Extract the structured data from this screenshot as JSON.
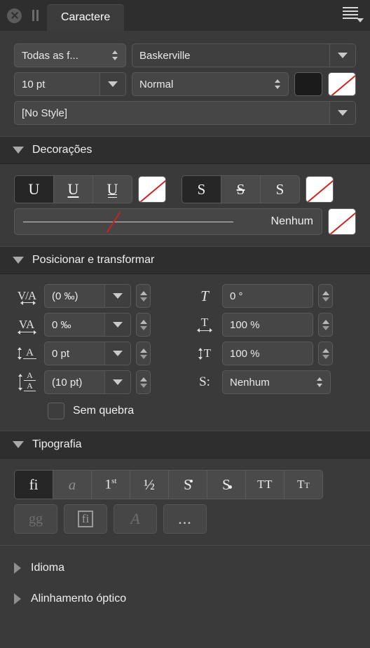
{
  "titlebar": {
    "close_icon": "close-icon",
    "pause_icon": "pause-icon",
    "tab_label": "Caractere",
    "menu_icon": "hamburger-menu-icon"
  },
  "font": {
    "family_filter": "Todas as f...",
    "family_name": "Baskerville",
    "size": "10 pt",
    "style": "Normal",
    "fill_color": "#1b1b1b",
    "stroke_color": "none",
    "paragraph_style": "[No Style]"
  },
  "decorations": {
    "title": "Decorações",
    "underline": [
      "U",
      "U",
      "U"
    ],
    "underline_selected": 0,
    "underline_color": "none",
    "strikethrough": [
      "S",
      "S",
      "S"
    ],
    "strikethrough_selected": 0,
    "strikethrough_color": "none",
    "line_style_label": "Nenhum",
    "line_style_color": "none"
  },
  "transform": {
    "title": "Posicionar e transformar",
    "kerning": {
      "icon": "kerning-icon",
      "value": "(0 ‰)"
    },
    "tracking": {
      "icon": "tracking-icon",
      "value": "0 ‰"
    },
    "baseline": {
      "icon": "baseline-shift-icon",
      "value": "0 pt"
    },
    "leading": {
      "icon": "leading-icon",
      "value": "(10 pt)"
    },
    "skew": {
      "icon": "skew-icon",
      "value": "0 °"
    },
    "hscale": {
      "icon": "horizontal-scale-icon",
      "value": "100 %"
    },
    "vscale": {
      "icon": "vertical-scale-icon",
      "value": "100 %"
    },
    "caps": {
      "icon": "small-caps-icon",
      "label": "S:",
      "value": "Nenhum"
    },
    "no_break_label": "Sem quebra",
    "no_break_checked": false
  },
  "typography": {
    "title": "Tipografia",
    "row1": [
      {
        "name": "ligatures-button",
        "glyph": "fi",
        "selected": true,
        "enabled": true
      },
      {
        "name": "italic-alternates-button",
        "glyph": "a",
        "selected": false,
        "enabled": true
      },
      {
        "name": "ordinals-button",
        "glyph": "1st",
        "selected": false,
        "enabled": true
      },
      {
        "name": "fractions-button",
        "glyph": "½",
        "selected": false,
        "enabled": true
      },
      {
        "name": "superscript-button",
        "glyph": "S",
        "selected": false,
        "enabled": true
      },
      {
        "name": "subscript-button",
        "glyph": "S",
        "selected": false,
        "enabled": true
      },
      {
        "name": "all-caps-button",
        "glyph": "TT",
        "selected": false,
        "enabled": true
      },
      {
        "name": "small-caps-button",
        "glyph": "TT",
        "selected": false,
        "enabled": true
      }
    ],
    "row2": [
      {
        "name": "alternates-button",
        "glyph": "gg",
        "enabled": false
      },
      {
        "name": "glyph-box-button",
        "glyph": "fi",
        "enabled": true
      },
      {
        "name": "swash-button",
        "glyph": "A",
        "enabled": false
      },
      {
        "name": "more-options-button",
        "glyph": "...",
        "enabled": true
      }
    ]
  },
  "sections": {
    "language": "Idioma",
    "optical_alignment": "Alinhamento óptico"
  }
}
